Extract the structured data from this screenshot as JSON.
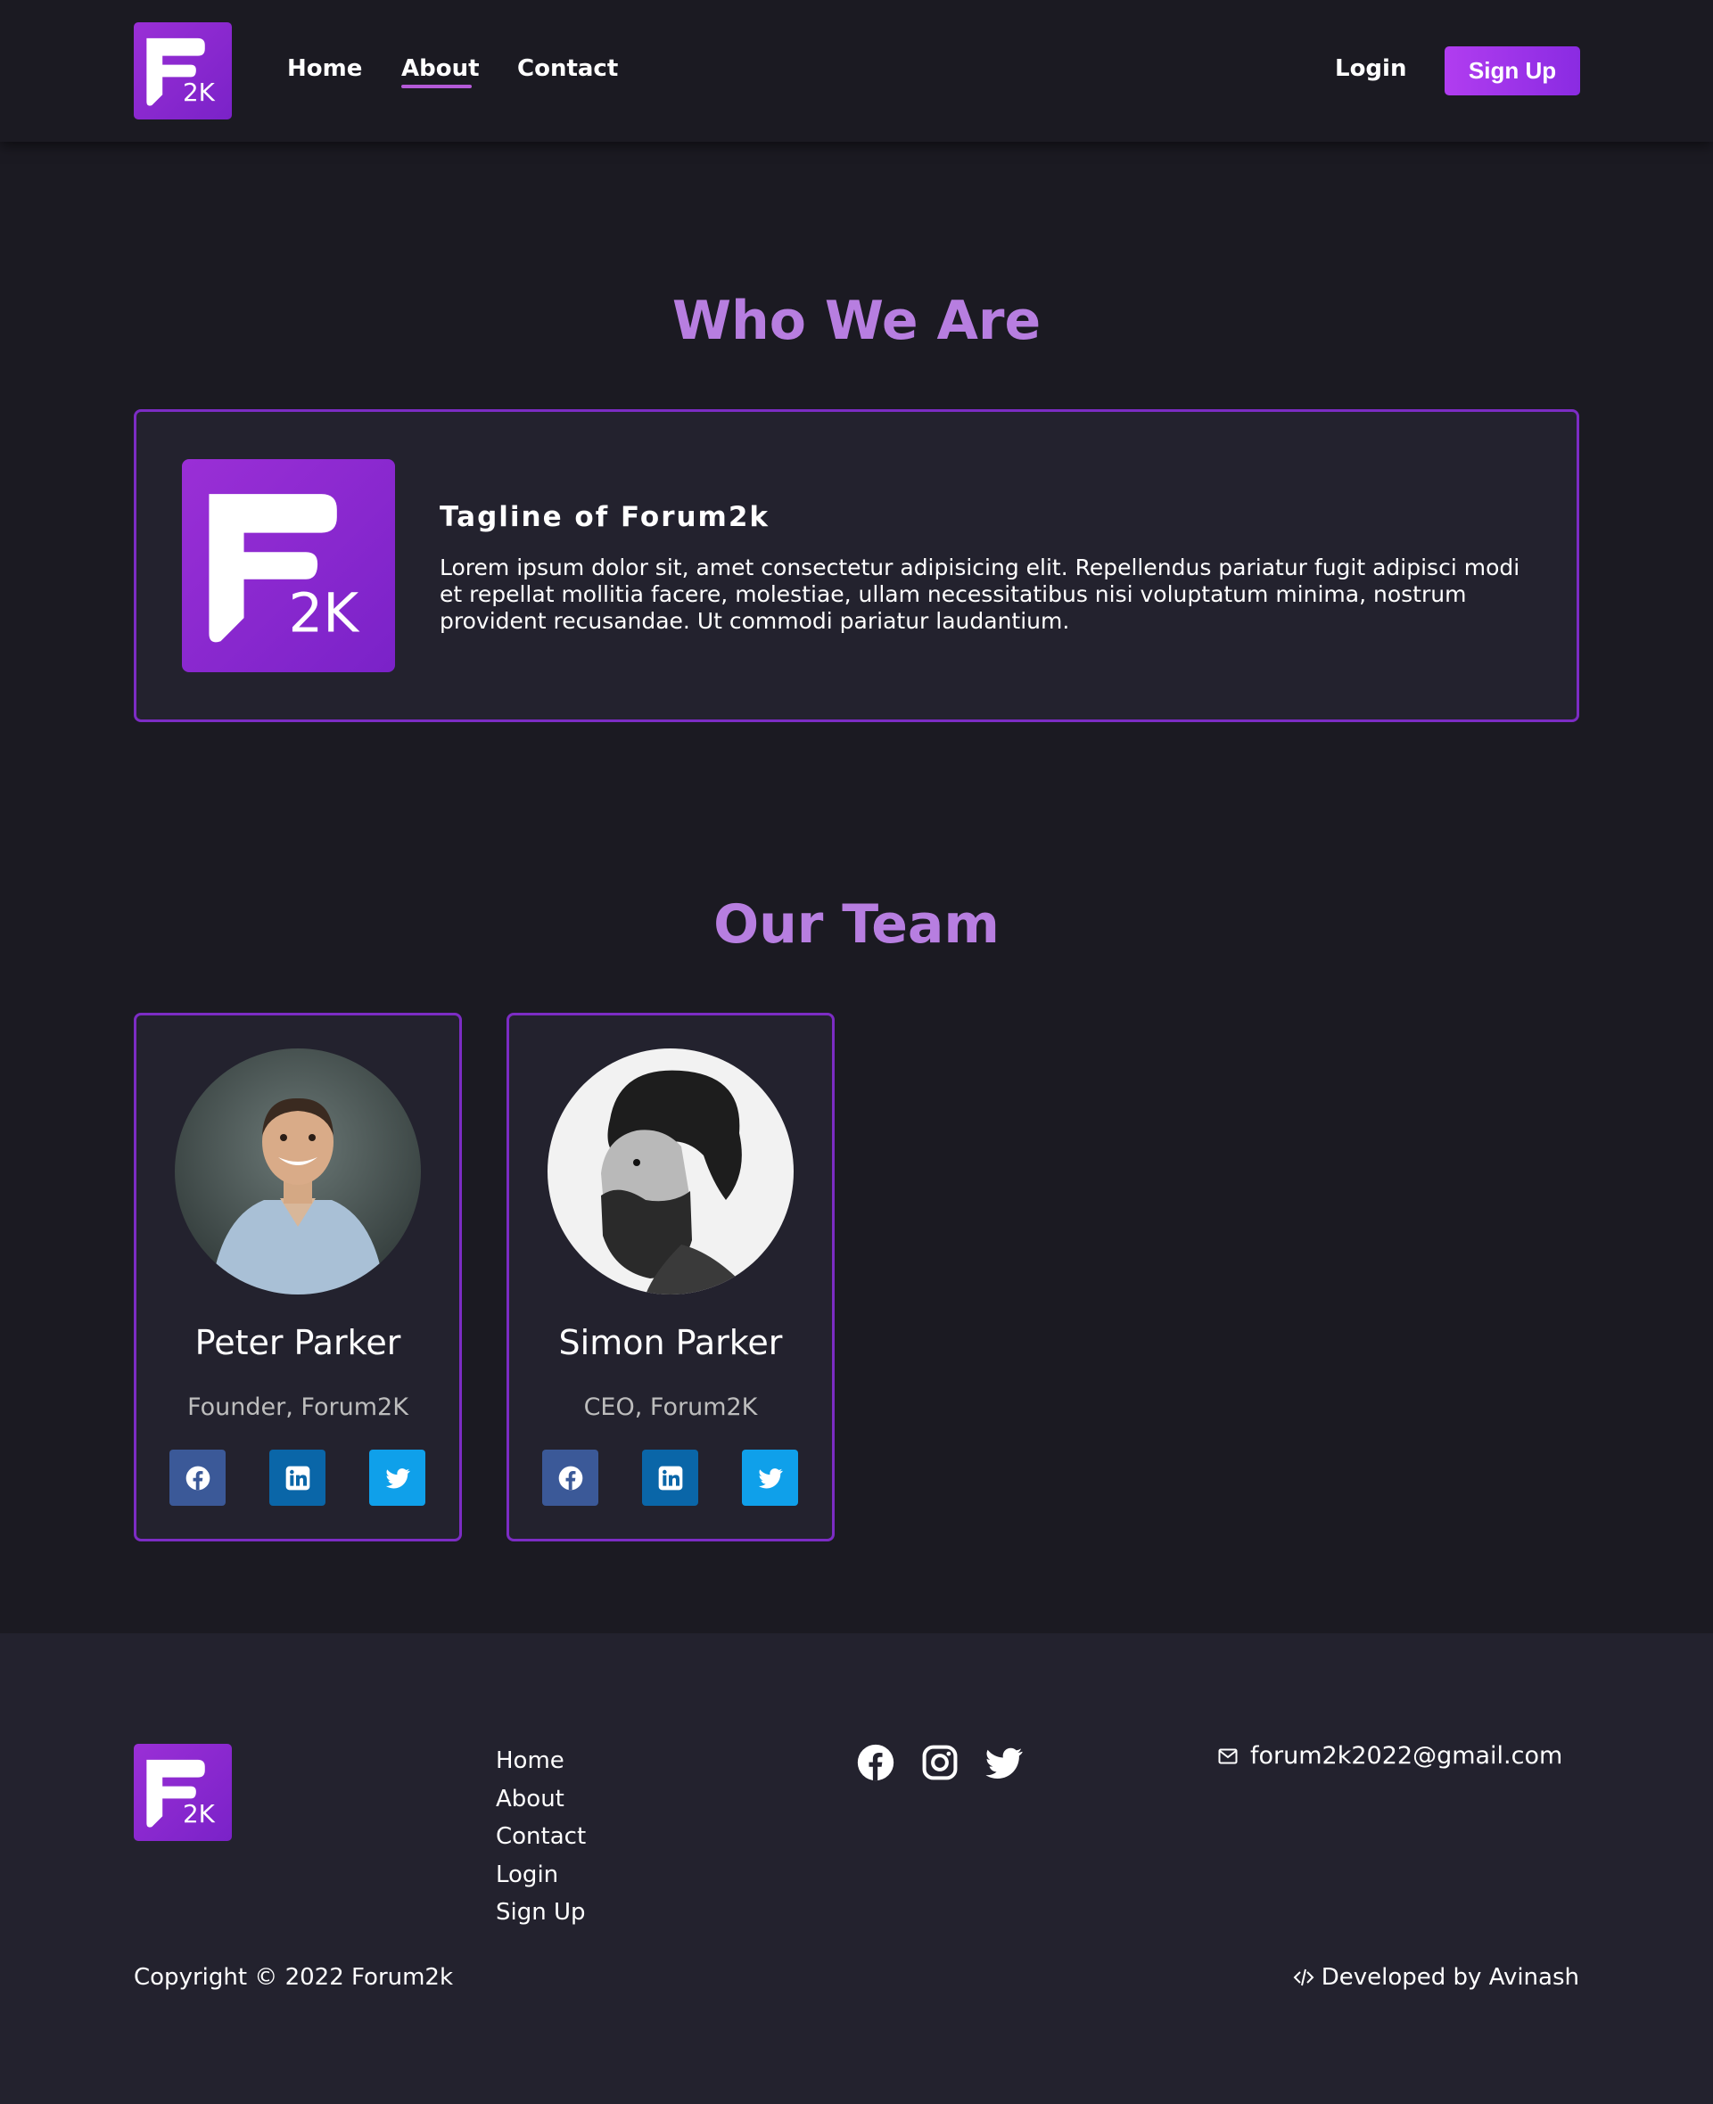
{
  "brand": {
    "logo_letter": "F",
    "logo_suffix": "2K",
    "accent": "#8a2be2",
    "title_color": "#b77ee0"
  },
  "nav": {
    "links": [
      {
        "label": "Home"
      },
      {
        "label": "About",
        "active": true
      },
      {
        "label": "Contact"
      }
    ],
    "login_label": "Login",
    "signup_label": "Sign Up"
  },
  "about": {
    "title": "Who We Are",
    "tagline": "Tagline of Forum2k",
    "text": "Lorem ipsum dolor sit, amet consectetur adipisicing elit. Repellendus pariatur fugit adipisci modi et repellat mollitia facere, molestiae, ullam necessitatibus nisi voluptatum minima, nostrum provident recusandae. Ut commodi pariatur laudantium."
  },
  "team": {
    "title": "Our Team",
    "members": [
      {
        "name": "Peter Parker",
        "role": "Founder, Forum2K",
        "avatar": "smiling-man-photo"
      },
      {
        "name": "Simon Parker",
        "role": "CEO, Forum2K",
        "avatar": "bearded-man-bw-photo"
      }
    ],
    "social_colors": {
      "facebook": "#3b5998",
      "linkedin": "#0a66a8",
      "twitter": "#0fa0ea"
    }
  },
  "footer": {
    "links": [
      "Home",
      "About",
      "Contact",
      "Login",
      "Sign Up"
    ],
    "social_icons": [
      "facebook-icon",
      "instagram-icon",
      "twitter-icon"
    ],
    "email": "forum2k2022@gmail.com",
    "copyright": "Copyright © 2022 Forum2k",
    "developer": "Developed by Avinash"
  }
}
